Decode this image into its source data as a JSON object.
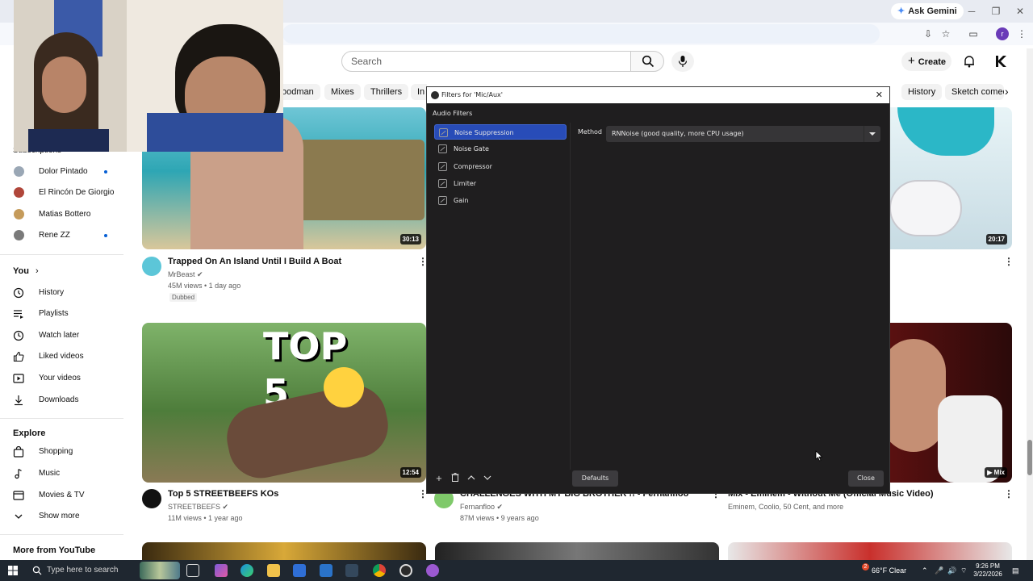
{
  "browser": {
    "gemini_label": "Ask Gemini",
    "profile_initial": "r"
  },
  "youtube": {
    "search_placeholder": "Search",
    "create_label": "Create",
    "chips": [
      "oodman",
      "Mixes",
      "Thrillers",
      "In",
      "History",
      "Sketch comedy"
    ],
    "sidebar": {
      "subscriptions_head": "Subscriptions",
      "subs": [
        {
          "name": "Dolor Pintado",
          "dot": true,
          "color": "#9aa7b5"
        },
        {
          "name": "El Rincón De Giorgio",
          "dot": false,
          "color": "#b0463a"
        },
        {
          "name": "Matias Bottero",
          "dot": false,
          "color": "#c59b5b"
        },
        {
          "name": "Rene ZZ",
          "dot": true,
          "color": "#7a7a7a"
        }
      ],
      "you_head": "You",
      "you_items": [
        "History",
        "Playlists",
        "Watch later",
        "Liked videos",
        "Your videos",
        "Downloads"
      ],
      "explore_head": "Explore",
      "explore_items": [
        "Shopping",
        "Music",
        "Movies & TV",
        "Show more"
      ],
      "more_head": "More from YouTube"
    },
    "videos": [
      {
        "title": "Trapped On An Island Until I Build A Boat",
        "channel": "MrBeast",
        "meta": "45M views • 1 day ago",
        "duration": "30:13",
        "badge": "Dubbed"
      },
      {
        "title": "",
        "channel": "",
        "meta": "",
        "duration": "20:17"
      },
      {
        "title": "Top 5 STREETBEEFS KOs",
        "channel": "STREETBEEFS",
        "meta": "11M views • 1 year ago",
        "duration": "12:54",
        "thumb_text": "TOP 5"
      },
      {
        "title": "CHALLENGES WITH MY BIG BROTHER !! - Fernanfloo",
        "channel": "Fernanfloo",
        "meta": "87M views • 9 years ago"
      },
      {
        "title": "Mix - Eminem - Without Me (Official Music Video)",
        "channel": "Eminem, Coolio, 50 Cent, and more",
        "duration": "Mix"
      }
    ]
  },
  "obs": {
    "title": "Filters for 'Mic/Aux'",
    "section_label": "Audio Filters",
    "filters": [
      "Noise Suppression",
      "Noise Gate",
      "Compressor",
      "Limiter",
      "Gain"
    ],
    "selected_index": 0,
    "method_label": "Method",
    "method_value": "RNNoise (good quality, more CPU usage)",
    "defaults_label": "Defaults",
    "close_label": "Close"
  },
  "taskbar": {
    "search_placeholder": "Type here to search",
    "weather": "66°F  Clear",
    "time": "9:26 PM",
    "date": "3/22/2026",
    "notification_count": "2"
  }
}
